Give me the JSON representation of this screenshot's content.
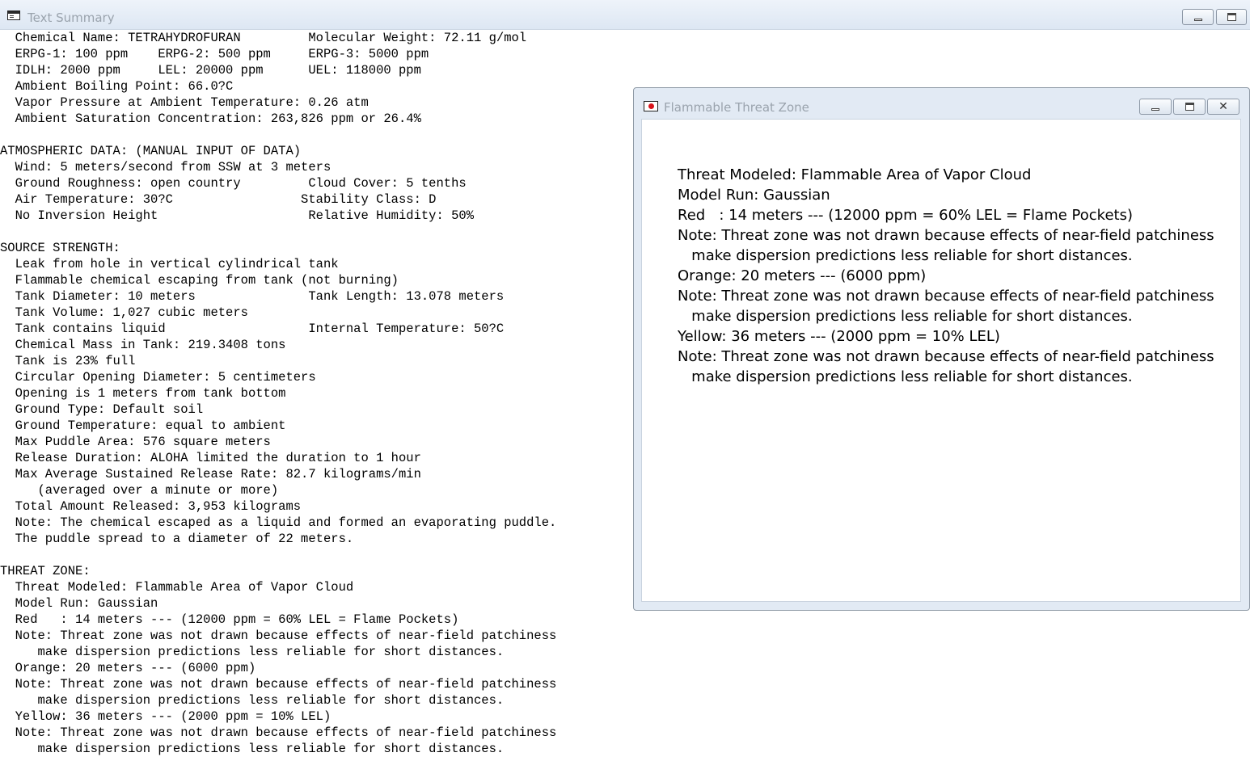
{
  "text_summary_window": {
    "title": "Text Summary",
    "lines": [
      "  Chemical Name: TETRAHYDROFURAN         Molecular Weight: 72.11 g/mol",
      "  ERPG-1: 100 ppm    ERPG-2: 500 ppm     ERPG-3: 5000 ppm",
      "  IDLH: 2000 ppm     LEL: 20000 ppm      UEL: 118000 ppm",
      "  Ambient Boiling Point: 66.0?C",
      "  Vapor Pressure at Ambient Temperature: 0.26 atm",
      "  Ambient Saturation Concentration: 263,826 ppm or 26.4%",
      "",
      "ATMOSPHERIC DATA: (MANUAL INPUT OF DATA)",
      "  Wind: 5 meters/second from SSW at 3 meters",
      "  Ground Roughness: open country         Cloud Cover: 5 tenths",
      "  Air Temperature: 30?C                 Stability Class: D",
      "  No Inversion Height                    Relative Humidity: 50%",
      "",
      "SOURCE STRENGTH:",
      "  Leak from hole in vertical cylindrical tank",
      "  Flammable chemical escaping from tank (not burning)",
      "  Tank Diameter: 10 meters               Tank Length: 13.078 meters",
      "  Tank Volume: 1,027 cubic meters",
      "  Tank contains liquid                   Internal Temperature: 50?C",
      "  Chemical Mass in Tank: 219.3408 tons",
      "  Tank is 23% full",
      "  Circular Opening Diameter: 5 centimeters",
      "  Opening is 1 meters from tank bottom",
      "  Ground Type: Default soil",
      "  Ground Temperature: equal to ambient",
      "  Max Puddle Area: 576 square meters",
      "  Release Duration: ALOHA limited the duration to 1 hour",
      "  Max Average Sustained Release Rate: 82.7 kilograms/min",
      "     (averaged over a minute or more)",
      "  Total Amount Released: 3,953 kilograms",
      "  Note: The chemical escaped as a liquid and formed an evaporating puddle.",
      "  The puddle spread to a diameter of 22 meters.",
      "",
      "THREAT ZONE:",
      "  Threat Modeled: Flammable Area of Vapor Cloud",
      "  Model Run: Gaussian",
      "  Red   : 14 meters --- (12000 ppm = 60% LEL = Flame Pockets)",
      "  Note: Threat zone was not drawn because effects of near-field patchiness",
      "     make dispersion predictions less reliable for short distances.",
      "  Orange: 20 meters --- (6000 ppm)",
      "  Note: Threat zone was not drawn because effects of near-field patchiness",
      "     make dispersion predictions less reliable for short distances.",
      "  Yellow: 36 meters --- (2000 ppm = 10% LEL)",
      "  Note: Threat zone was not drawn because effects of near-field patchiness",
      "     make dispersion predictions less reliable for short distances."
    ]
  },
  "flammable_threat_zone_window": {
    "title": "Flammable Threat Zone",
    "lines": [
      "Threat Modeled: Flammable Area of Vapor Cloud",
      "Model Run: Gaussian",
      "Red   : 14 meters --- (12000 ppm = 60% LEL = Flame Pockets)",
      "Note: Threat zone was not drawn because effects of near-field patchiness",
      "   make dispersion predictions less reliable for short distances.",
      "Orange: 20 meters --- (6000 ppm)",
      "Note: Threat zone was not drawn because effects of near-field patchiness",
      "   make dispersion predictions less reliable for short distances.",
      "Yellow: 36 meters --- (2000 ppm = 10% LEL)",
      "Note: Threat zone was not drawn because effects of near-field patchiness",
      "   make dispersion predictions less reliable for short distances."
    ]
  },
  "icons": {
    "text_summary": "text-summary-window-icon",
    "threat_zone": "threat-zone-flag-icon",
    "minimize": "minimize-icon",
    "maximize": "maximize-icon",
    "close": "close-icon"
  },
  "colors": {
    "titlebar": "#dde7f3",
    "threat_icon_red": "#d8131b",
    "title_text": "#9aa3ad"
  }
}
